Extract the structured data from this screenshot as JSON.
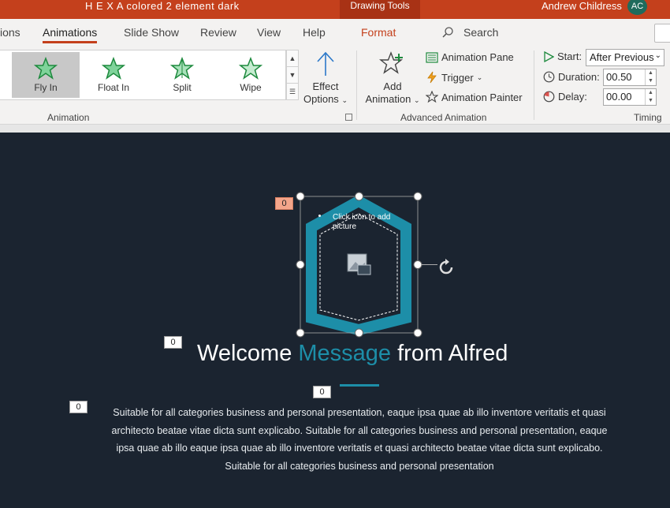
{
  "titlebar": {
    "doc_title": "H E X A colored 2 element dark",
    "context_tab": "Drawing Tools",
    "user_name": "Andrew Childress",
    "user_initials": "AC"
  },
  "tabs": {
    "partial": "ions",
    "animations": "Animations",
    "slide_show": "Slide Show",
    "review": "Review",
    "view": "View",
    "help": "Help",
    "format": "Format",
    "search": "Search"
  },
  "ribbon": {
    "gallery": [
      {
        "label": "Fly In",
        "icon": "star-fly-in-icon",
        "selected": true
      },
      {
        "label": "Float In",
        "icon": "star-float-in-icon",
        "selected": false
      },
      {
        "label": "Split",
        "icon": "star-split-icon",
        "selected": false
      },
      {
        "label": "Wipe",
        "icon": "star-wipe-icon",
        "selected": false
      }
    ],
    "effect_options_line1": "Effect",
    "effect_options_line2": "Options",
    "animation_group_label": "Animation",
    "add_animation_line1": "Add",
    "add_animation_line2": "Animation",
    "animation_pane": "Animation Pane",
    "trigger": "Trigger",
    "animation_painter": "Animation Painter",
    "advanced_group_label": "Advanced Animation",
    "start_label": "Start:",
    "start_value": "After Previous",
    "duration_label": "Duration:",
    "duration_value": "00.50",
    "delay_label": "Delay:",
    "delay_value": "00.00",
    "timing_group_label": "Timing"
  },
  "slide": {
    "tag_image": "0",
    "tag_title": "0",
    "tag_divider": "0",
    "tag_body": "0",
    "placeholder_text": "Click icon to add picture",
    "headline_part1": "Welcome ",
    "headline_accent": "Message",
    "headline_part2": " from Alfred",
    "body_text": "Suitable for all categories business and personal presentation, eaque ipsa quae ab illo inventore veritatis et quasi architecto beatae vitae dicta sunt explicabo. Suitable for all categories business and personal presentation, eaque ipsa quae ab illo eaque ipsa quae ab illo inventore veritatis et quasi architecto beatae vitae dicta sunt explicabo. Suitable for all categories business and personal presentation"
  },
  "colors": {
    "titlebar": "#c4401c",
    "accent": "#1d8ea8",
    "slide_bg": "#1b2430",
    "star_green": "#2fa84f"
  }
}
